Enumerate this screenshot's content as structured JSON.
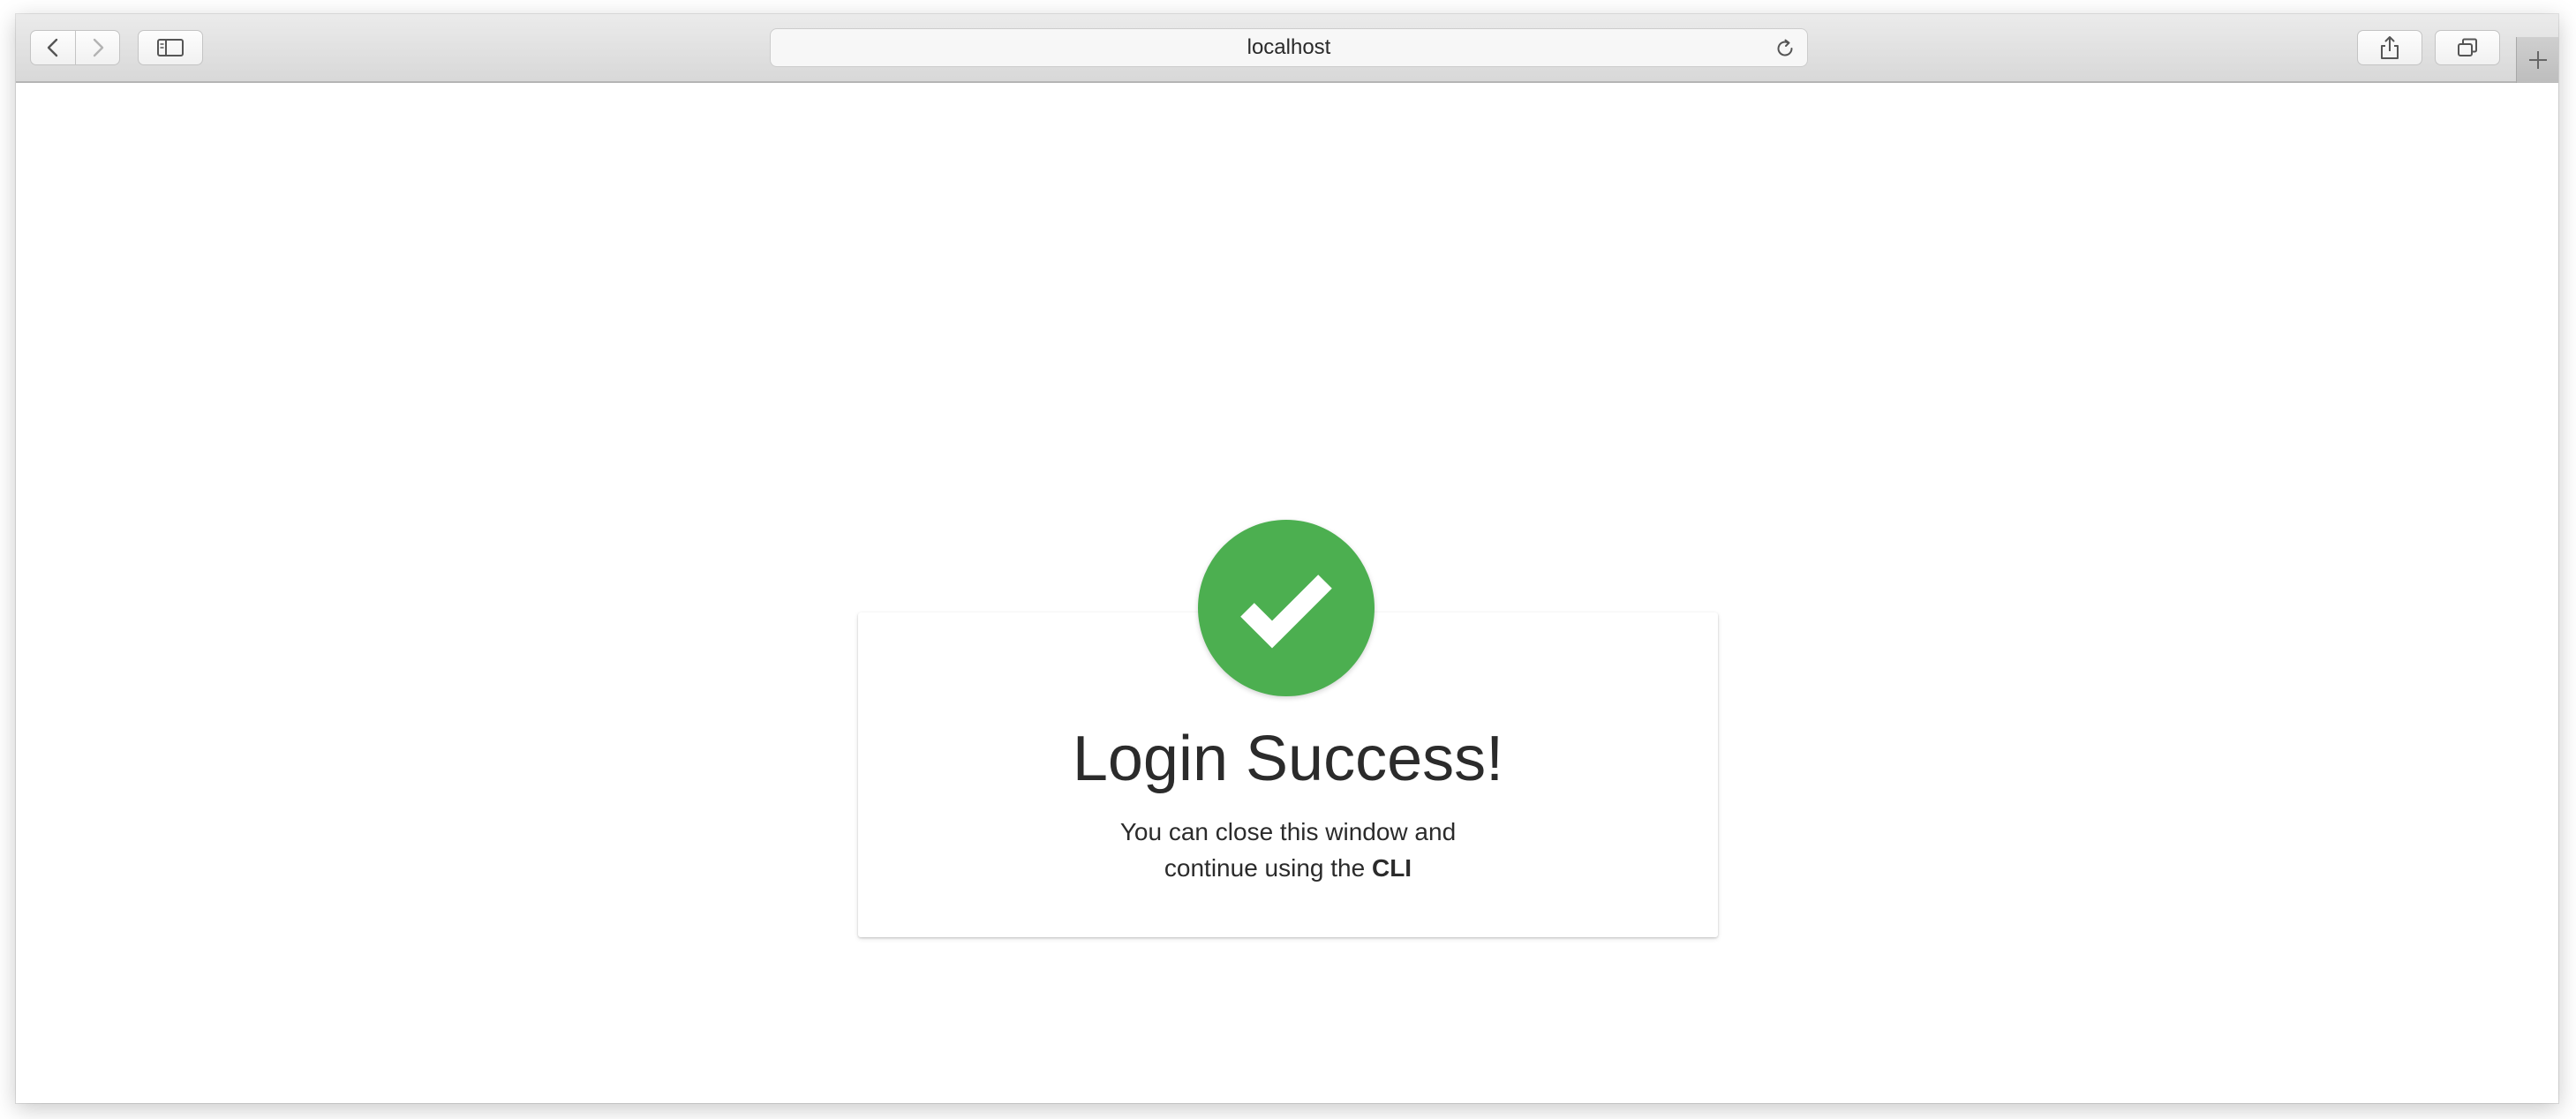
{
  "browser": {
    "address": "localhost"
  },
  "toolbar": {
    "back_icon": "chevron-left-icon",
    "forward_icon": "chevron-right-icon",
    "sidebar_icon": "sidebar-icon",
    "reload_icon": "reload-icon",
    "share_icon": "share-icon",
    "tabs_icon": "tabs-overview-icon",
    "new_tab_icon": "plus-icon"
  },
  "page": {
    "success_icon": "checkmark-icon",
    "success_color": "#4caf50",
    "title": "Login Success!",
    "message_line1": "You can close this window and",
    "message_line2": "continue using the ",
    "message_bold": "CLI"
  }
}
